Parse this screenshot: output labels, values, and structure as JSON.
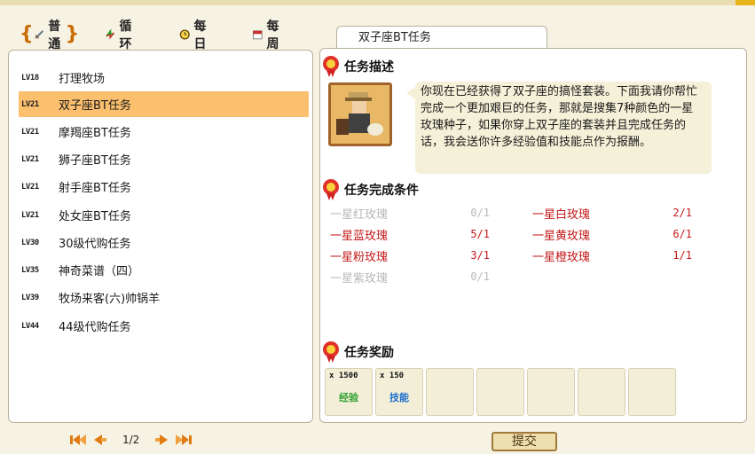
{
  "tabs": [
    {
      "label": "普通",
      "icon": "sword-icon",
      "active": true
    },
    {
      "label": "循环",
      "icon": "cycle-arrows-icon",
      "active": false
    },
    {
      "label": "每日",
      "icon": "clock-icon",
      "active": false
    },
    {
      "label": "每周",
      "icon": "calendar-icon",
      "active": false
    }
  ],
  "quests": [
    {
      "level": "LV18",
      "name": "打理牧场",
      "selected": false
    },
    {
      "level": "LV21",
      "name": "双子座BT任务",
      "selected": true
    },
    {
      "level": "LV21",
      "name": "摩羯座BT任务",
      "selected": false
    },
    {
      "level": "LV21",
      "name": "狮子座BT任务",
      "selected": false
    },
    {
      "level": "LV21",
      "name": "射手座BT任务",
      "selected": false
    },
    {
      "level": "LV21",
      "name": "处女座BT任务",
      "selected": false
    },
    {
      "level": "LV30",
      "name": "30级代购任务",
      "selected": false
    },
    {
      "level": "LV35",
      "name": "神奇菜谱（四）",
      "selected": false
    },
    {
      "level": "LV39",
      "name": "牧场来客(六)帅锅羊",
      "selected": false
    },
    {
      "level": "LV44",
      "name": "44级代购任务",
      "selected": false
    }
  ],
  "pager": {
    "text": "1/2"
  },
  "detail": {
    "tab_title": "双子座BT任务",
    "desc_title": "任务描述",
    "description": "你现在已经获得了双子座的搞怪套装。下面我请你帮忙完成一个更加艰巨的任务，那就是搜集7种颜色的一星玫瑰种子，如果你穿上双子座的套装并且完成任务的话，我会送你许多经验值和技能点作为报酬。",
    "cond_title": "任务完成条件",
    "requirements": [
      {
        "name": "一星红玫瑰",
        "count": "0/1",
        "done": false
      },
      {
        "name": "一星白玫瑰",
        "count": "2/1",
        "done": true
      },
      {
        "name": "一星蓝玫瑰",
        "count": "5/1",
        "done": true
      },
      {
        "name": "一星黄玫瑰",
        "count": "6/1",
        "done": true
      },
      {
        "name": "一星粉玫瑰",
        "count": "3/1",
        "done": true
      },
      {
        "name": "一星橙玫瑰",
        "count": "1/1",
        "done": true
      },
      {
        "name": "一星紫玫瑰",
        "count": "0/1",
        "done": false
      }
    ],
    "reward_title": "任务奖励",
    "rewards": [
      {
        "qty": "x 1500",
        "label": "经验",
        "color": "#2ea02e"
      },
      {
        "qty": "x 150",
        "label": "技能",
        "color": "#1f6fd0"
      }
    ]
  },
  "submit_label": "提交",
  "colors": {
    "selected_row": "#fbbf6e",
    "incomplete": "#b8b8b8",
    "complete": "#c41818",
    "accent": "#e07b12"
  }
}
